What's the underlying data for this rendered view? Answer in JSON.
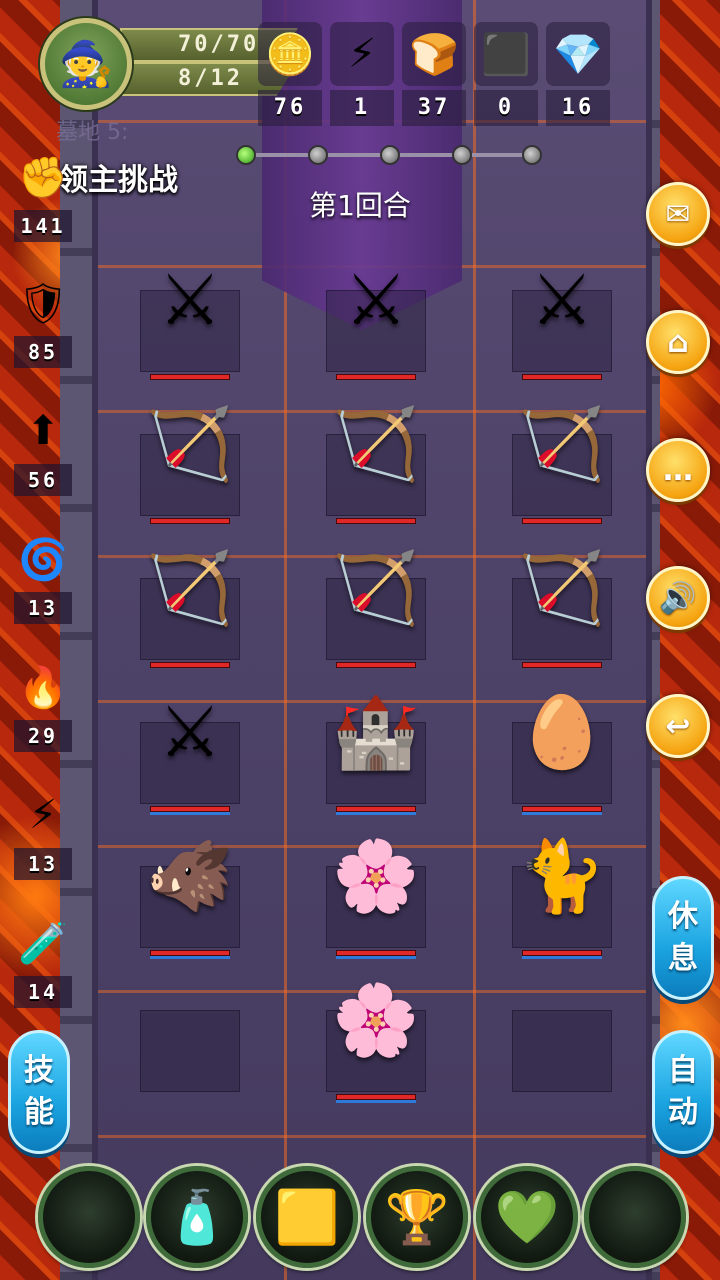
{
  "player": {
    "hp": "70/70",
    "energy": "8/12"
  },
  "resources": [
    {
      "name": "coin-icon",
      "glyph": "🪙",
      "value": "76"
    },
    {
      "name": "lightning-icon",
      "glyph": "⚡",
      "value": "1"
    },
    {
      "name": "bread-icon",
      "glyph": "🍞",
      "value": "37"
    },
    {
      "name": "ore-icon",
      "glyph": "⬛",
      "value": "0"
    },
    {
      "name": "crystal-icon",
      "glyph": "💎",
      "value": "16"
    }
  ],
  "level": {
    "ghost_label": "墓地 5:",
    "title": "领主挑战",
    "round": "第1回合"
  },
  "left_stats": [
    {
      "name": "fist-icon",
      "glyph": "✊",
      "value": "141"
    },
    {
      "name": "shield-icon",
      "glyph": "🛡",
      "value": "85"
    },
    {
      "name": "flame-arrow-icon",
      "glyph": "⬆",
      "value": "56"
    },
    {
      "name": "water-swirl-icon",
      "glyph": "🌀",
      "value": "13"
    },
    {
      "name": "fire-orb-icon",
      "glyph": "🔥",
      "value": "29"
    },
    {
      "name": "lightning-bolt-icon",
      "glyph": "⚡",
      "value": "13"
    },
    {
      "name": "poison-icon",
      "glyph": "🧪",
      "value": "14"
    }
  ],
  "right_buttons": [
    {
      "name": "mail-button",
      "glyph": "✉"
    },
    {
      "name": "home-button",
      "glyph": "⌂"
    },
    {
      "name": "chat-button",
      "glyph": "…"
    },
    {
      "name": "sound-button",
      "glyph": "🔊"
    },
    {
      "name": "back-button",
      "glyph": "↩"
    }
  ],
  "side_buttons": {
    "rest": [
      "休",
      "息"
    ],
    "auto": [
      "自",
      "动"
    ],
    "skill": [
      "技",
      "能"
    ]
  },
  "grid": [
    [
      "⚔",
      "⚔",
      "⚔"
    ],
    [
      "🏹",
      "🏹",
      "🏹"
    ],
    [
      "🏹",
      "🏹",
      "🏹"
    ],
    [
      "⚔",
      "🏰",
      "🥚"
    ],
    [
      "🐗",
      "🌸",
      "🐈"
    ],
    [
      "",
      "🌸",
      ""
    ]
  ],
  "bottom_slots": [
    {
      "name": "empty-slot",
      "glyph": ""
    },
    {
      "name": "love-potion-icon",
      "glyph": "🧴"
    },
    {
      "name": "gold-bar-icon",
      "glyph": "🟨"
    },
    {
      "name": "golden-wings-icon",
      "glyph": "🏆"
    },
    {
      "name": "green-gem-icon",
      "glyph": "💚"
    },
    {
      "name": "empty-slot",
      "glyph": ""
    }
  ]
}
